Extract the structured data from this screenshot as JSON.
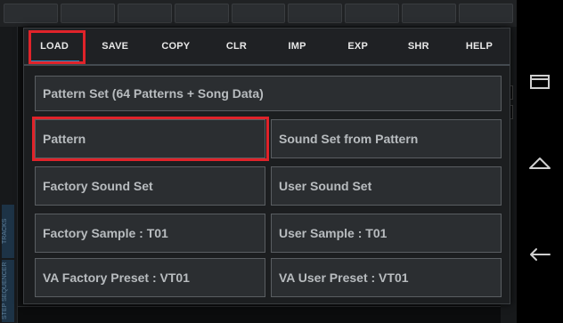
{
  "tabs": [
    {
      "label": "LOAD",
      "active": true
    },
    {
      "label": "SAVE"
    },
    {
      "label": "COPY"
    },
    {
      "label": "CLR"
    },
    {
      "label": "IMP"
    },
    {
      "label": "EXP"
    },
    {
      "label": "SHR"
    },
    {
      "label": "HELP"
    }
  ],
  "options": {
    "pattern_set": "Pattern Set (64 Patterns + Song Data)",
    "pattern": "Pattern",
    "sound_set_from_pattern": "Sound Set from Pattern",
    "factory_sound_set": "Factory Sound Set",
    "user_sound_set": "User Sound Set",
    "factory_sample": "Factory Sample : T01",
    "user_sample": "User Sample : T01",
    "va_factory_preset": "VA Factory Preset : VT01",
    "va_user_preset": "VA User Preset : VT01"
  },
  "background": {
    "left_tabs": [
      "TRACKS",
      "STEP SEQUENCER"
    ]
  },
  "colors": {
    "accent": "#2a8fc9",
    "highlight": "#e0232a",
    "button_bg": "#2b2e31",
    "button_text": "#b8bcbf"
  },
  "icons": {
    "nav": [
      "recent-apps-icon",
      "home-icon",
      "back-icon"
    ]
  }
}
